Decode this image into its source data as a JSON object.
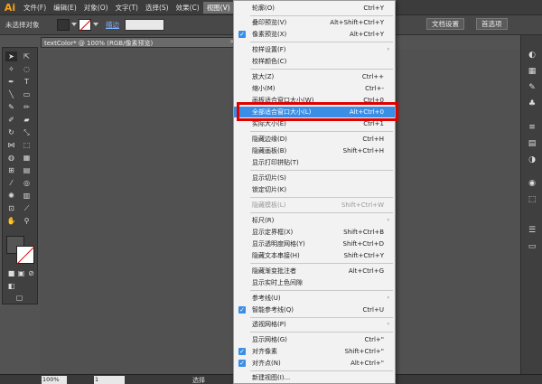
{
  "app": {
    "logo": "Ai"
  },
  "menubar": {
    "items": [
      {
        "label": "文件(F)"
      },
      {
        "label": "编辑(E)"
      },
      {
        "label": "对象(O)"
      },
      {
        "label": "文字(T)"
      },
      {
        "label": "选择(S)"
      },
      {
        "label": "效果(C)"
      },
      {
        "label": "视图(V)"
      }
    ],
    "active": "视图(V)"
  },
  "controlbar": {
    "selection_status": "未选择对象",
    "stroke_label": "描边",
    "document_settings": "文档设置",
    "preferences": "首选项"
  },
  "document_tab": {
    "title": "textColor* @ 100% (RGB/像素预览)",
    "close": "×"
  },
  "statusbar": {
    "zoom": "100%",
    "page": "1",
    "status": "选择"
  },
  "dropdown_menu": {
    "items": [
      {
        "label": "轮廓(O)",
        "shortcut": "Ctrl+Y"
      },
      {
        "label": "叠印预览(V)",
        "shortcut": "Alt+Shift+Ctrl+Y"
      },
      {
        "label": "像素预览(X)",
        "shortcut": "Alt+Ctrl+Y",
        "checked": true
      },
      {
        "label": "校样设置(F)",
        "submenu": true
      },
      {
        "label": "校样颜色(C)"
      },
      {
        "label": "放大(Z)",
        "shortcut": "Ctrl++"
      },
      {
        "label": "缩小(M)",
        "shortcut": "Ctrl+-"
      },
      {
        "label": "画板适合窗口大小(W)",
        "shortcut": "Ctrl+0"
      },
      {
        "label": "全部适合窗口大小(L)",
        "shortcut": "Alt+Ctrl+0",
        "highlighted": true
      },
      {
        "label": "实际大小(E)",
        "shortcut": "Ctrl+1"
      },
      {
        "label": "隐藏边缘(D)",
        "shortcut": "Ctrl+H"
      },
      {
        "label": "隐藏画板(B)",
        "shortcut": "Shift+Ctrl+H"
      },
      {
        "label": "显示打印拼贴(T)"
      },
      {
        "label": "显示切片(S)"
      },
      {
        "label": "锁定切片(K)"
      },
      {
        "label": "隐藏模板(L)",
        "shortcut": "Shift+Ctrl+W",
        "disabled": true
      },
      {
        "label": "标尺(R)",
        "submenu": true
      },
      {
        "label": "显示定界框(X)",
        "shortcut": "Shift+Ctrl+B"
      },
      {
        "label": "显示透明度网格(Y)",
        "shortcut": "Shift+Ctrl+D"
      },
      {
        "label": "隐藏文本串接(H)",
        "shortcut": "Shift+Ctrl+Y"
      },
      {
        "label": "隐藏渐变批注者",
        "shortcut": "Alt+Ctrl+G"
      },
      {
        "label": "显示实时上色间隙"
      },
      {
        "label": "参考线(U)",
        "submenu": true
      },
      {
        "label": "智能参考线(Q)",
        "shortcut": "Ctrl+U",
        "checked": true
      },
      {
        "label": "透视网格(P)",
        "submenu": true
      },
      {
        "label": "显示网格(G)",
        "shortcut": "Ctrl+\""
      },
      {
        "label": "对齐像素",
        "shortcut": "Shift+Ctrl+\"",
        "checked": true
      },
      {
        "label": "对齐点(N)",
        "shortcut": "Alt+Ctrl+\"",
        "checked": true
      },
      {
        "label": "新建视图(I)..."
      }
    ]
  },
  "colors": {
    "highlight_box": "#e00000",
    "menu_background": "#f2f2f2",
    "check_blue": "#3a8ee6",
    "workspace": "#535353"
  }
}
